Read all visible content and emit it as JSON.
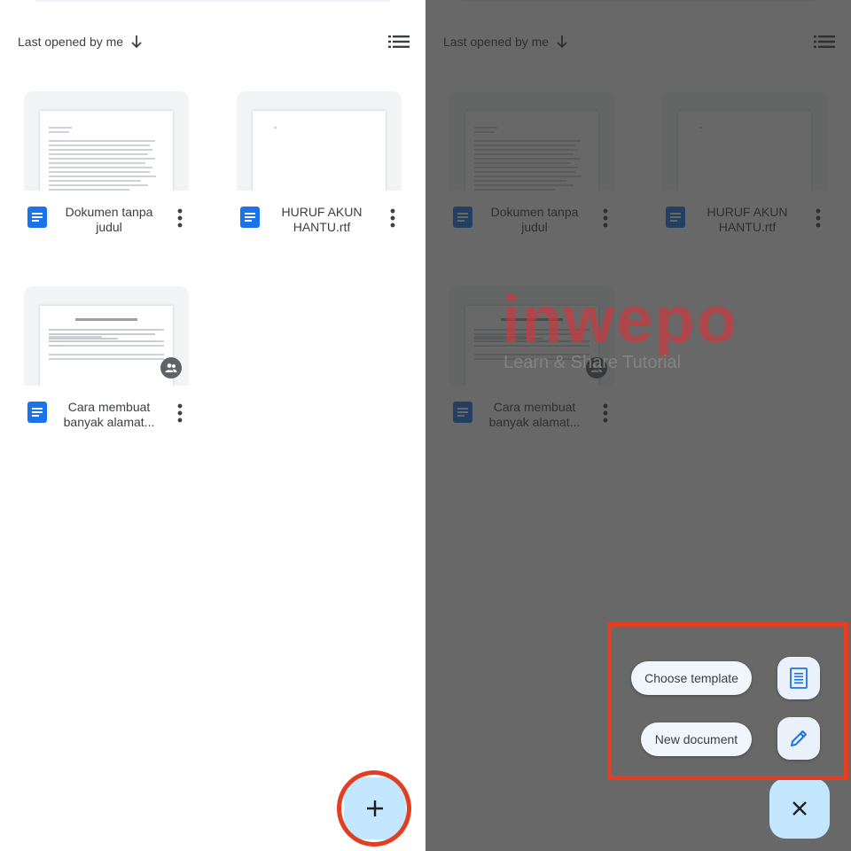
{
  "sort": {
    "label": "Last opened by me",
    "arrow_icon": "arrow-down-icon",
    "view_icon": "list-view-icon"
  },
  "files": [
    {
      "name": "Dokumen tanpa judul",
      "shared": false,
      "icon": "docs-icon"
    },
    {
      "name": "HURUF AKUN HANTU.rtf",
      "shared": false,
      "icon": "docs-icon"
    },
    {
      "name": "Cara membuat banyak alamat...",
      "shared": true,
      "icon": "docs-icon"
    }
  ],
  "fab": {
    "create_icon": "plus-icon",
    "close_icon": "close-icon"
  },
  "menu": {
    "choose_template_label": "Choose template",
    "choose_template_icon": "template-icon",
    "new_document_label": "New document",
    "new_document_icon": "pencil-icon"
  },
  "watermark": {
    "brand": "inwepo",
    "tagline": "Learn & Share Tutorial"
  },
  "colors": {
    "accent": "#1a73e8",
    "fab": "#c2e7ff",
    "annotation": "#e23f22",
    "watermark": "#d8343a"
  }
}
